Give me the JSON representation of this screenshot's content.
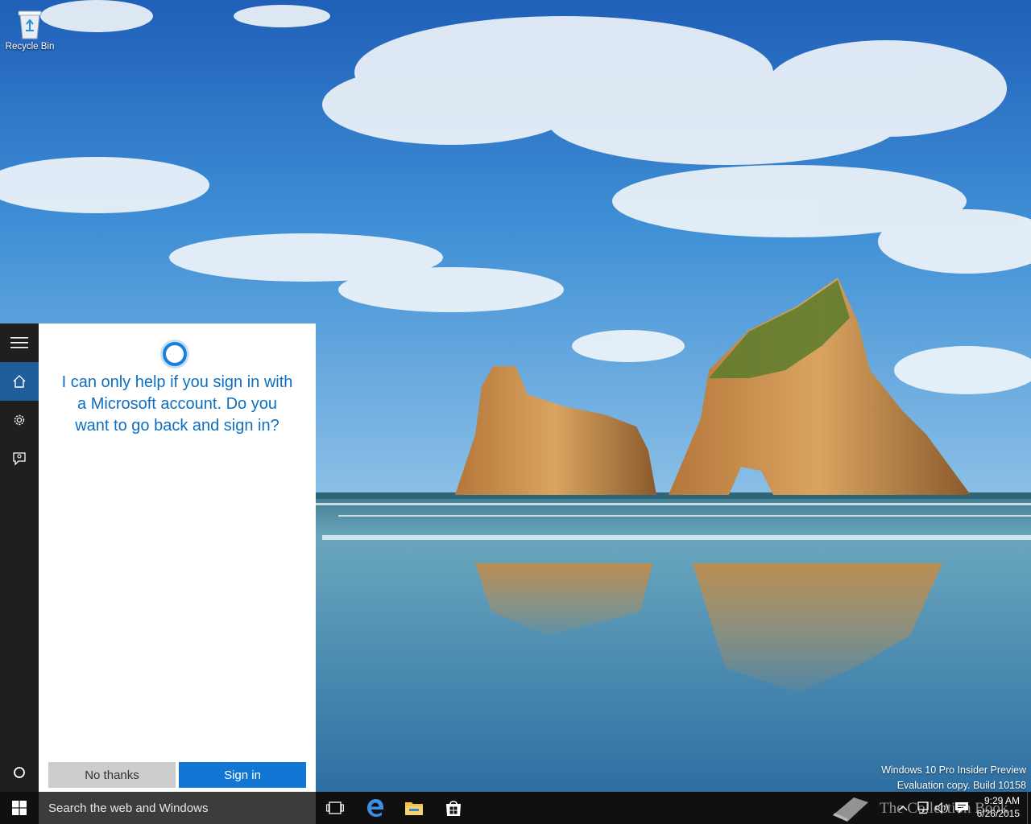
{
  "desktop": {
    "icons": [
      {
        "label": "Recycle Bin",
        "icon": "recycle-bin-icon"
      }
    ],
    "watermark": {
      "line1": "Windows 10 Pro Insider Preview",
      "line2": "Evaluation copy. Build 10158"
    },
    "overlay_watermark": {
      "text": "The Collection Book",
      "icon": "book-icon"
    }
  },
  "cortana": {
    "rail": [
      {
        "icon": "hamburger-menu-icon",
        "active": false
      },
      {
        "icon": "home-icon",
        "active": true
      },
      {
        "icon": "gear-icon",
        "active": false
      },
      {
        "icon": "feedback-icon",
        "active": false
      },
      {
        "icon": "cortana-circle-icon",
        "active": false
      }
    ],
    "message_lines": [
      "I can only help if you sign in with",
      "a Microsoft account. Do you",
      "want to go back and sign in?"
    ],
    "buttons": {
      "decline": "No thanks",
      "accept": "Sign in"
    },
    "colors": {
      "accent": "#1176d4",
      "rail_active": "#1e5f99",
      "message": "#0e6fc0"
    }
  },
  "taskbar": {
    "search_placeholder": "Search the web and Windows",
    "pinned": [
      {
        "icon": "task-view-icon"
      },
      {
        "icon": "edge-browser-icon"
      },
      {
        "icon": "file-explorer-icon"
      },
      {
        "icon": "store-icon"
      }
    ],
    "tray": [
      {
        "icon": "chevron-up-icon"
      },
      {
        "icon": "network-icon"
      },
      {
        "icon": "volume-icon"
      },
      {
        "icon": "action-center-icon"
      }
    ],
    "clock": {
      "time": "9:29 AM",
      "date": "6/26/2015"
    }
  }
}
